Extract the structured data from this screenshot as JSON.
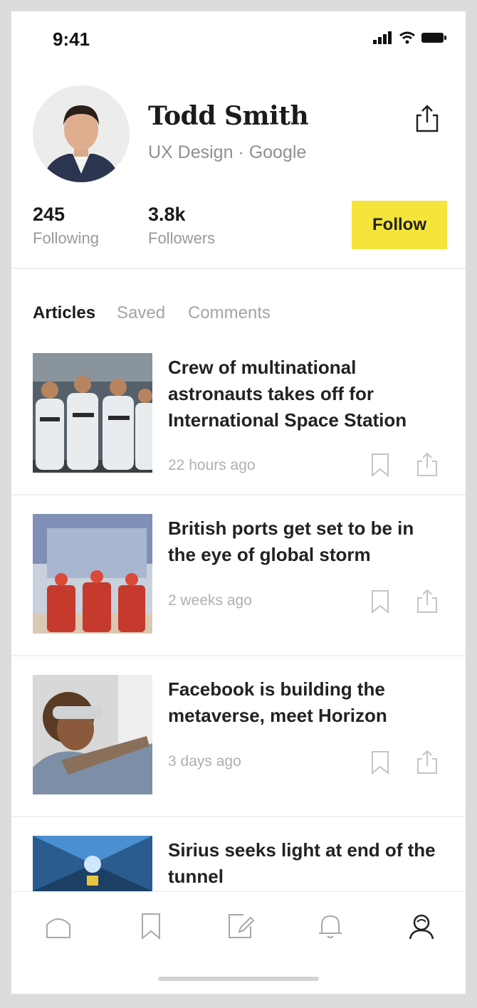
{
  "status_bar": {
    "time": "9:41",
    "icons": [
      "signal-icon",
      "wifi-icon",
      "battery-icon"
    ]
  },
  "profile": {
    "name": "Todd Smith",
    "subtitle": "UX Design · Google",
    "following_count": "245",
    "following_label": "Following",
    "followers_count": "3.8k",
    "followers_label": "Followers",
    "follow_label": "Follow"
  },
  "tabs": [
    {
      "label": "Articles",
      "active": true
    },
    {
      "label": "Saved",
      "active": false
    },
    {
      "label": "Comments",
      "active": false
    }
  ],
  "articles": [
    {
      "title": "Crew of multinational astronauts takes off for International Space Station",
      "time": "22 hours ago",
      "image": "astronauts-photo"
    },
    {
      "title": "British ports get set to be in the eye of global storm",
      "time": "2 weeks ago",
      "image": "port-workers-photo"
    },
    {
      "title": "Facebook is building the metaverse, meet Horizon",
      "time": "3 days ago",
      "image": "vr-headset-photo"
    },
    {
      "title": "Sirius seeks light at end of the tunnel",
      "time": "",
      "image": "tunnel-photo"
    }
  ],
  "tab_bar": [
    "home-icon",
    "bookmark-icon",
    "edit-icon",
    "bell-icon",
    "profile-icon"
  ],
  "colors": {
    "accent": "#f5e43a",
    "text": "#222222",
    "muted": "#9a9a9a"
  }
}
